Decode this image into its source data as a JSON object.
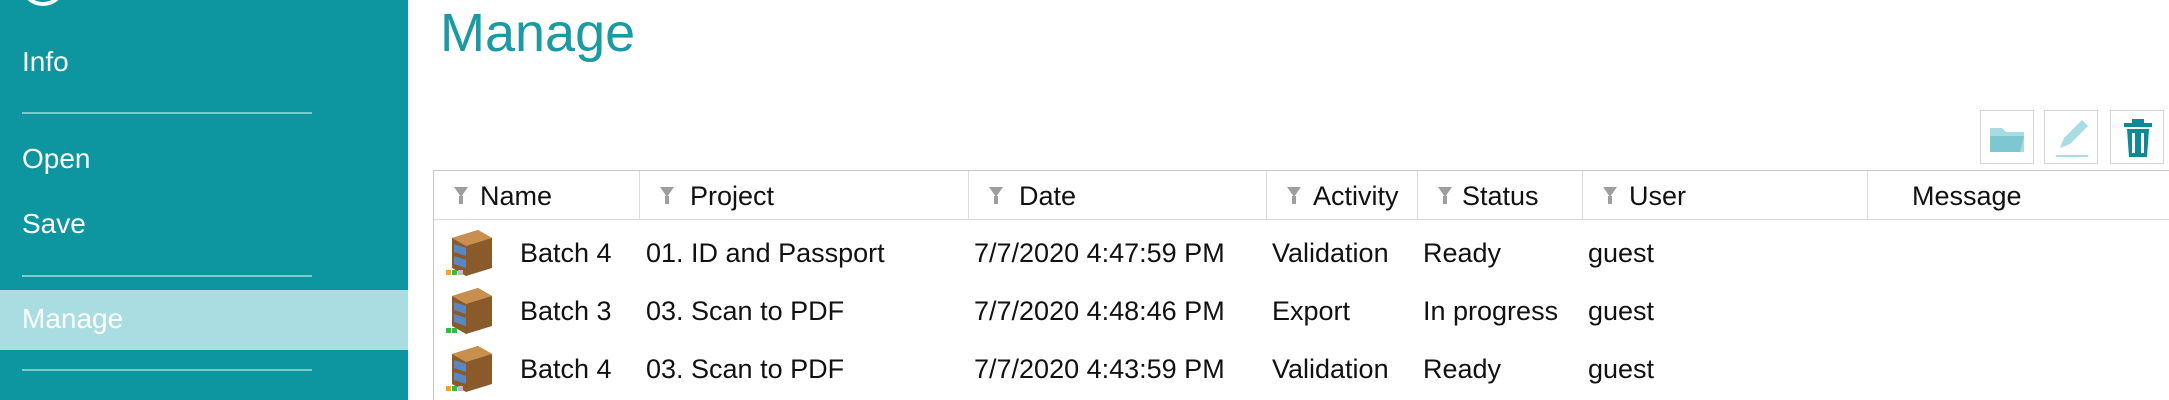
{
  "sidebar": {
    "items": [
      {
        "label": "Info"
      },
      {
        "label": "Open"
      },
      {
        "label": "Save"
      },
      {
        "label": "Manage",
        "selected": true
      }
    ]
  },
  "main": {
    "title": "Manage",
    "toolbar": [
      "open-folder-icon",
      "edit-pencil-icon",
      "trash-icon"
    ],
    "columns": [
      "Name",
      "Project",
      "Date",
      "Activity",
      "Status",
      "User",
      "Message"
    ],
    "rows": [
      {
        "name": "Batch 4",
        "project": "01. ID and Passport",
        "date": "7/7/2020 4:47:59 PM",
        "activity": "Validation",
        "status": "Ready",
        "user": "guest",
        "message": ""
      },
      {
        "name": "Batch 3",
        "project": "03. Scan to PDF",
        "date": "7/7/2020 4:48:46 PM",
        "activity": "Export",
        "status": "In progress",
        "user": "guest",
        "message": ""
      },
      {
        "name": "Batch 4",
        "project": "03. Scan to PDF",
        "date": "7/7/2020 4:43:59 PM",
        "activity": "Validation",
        "status": "Ready",
        "user": "guest",
        "message": ""
      }
    ]
  },
  "colors": {
    "sidebar": "#0d969f",
    "selected": "#a9dde1",
    "title": "#1a9aa3"
  }
}
